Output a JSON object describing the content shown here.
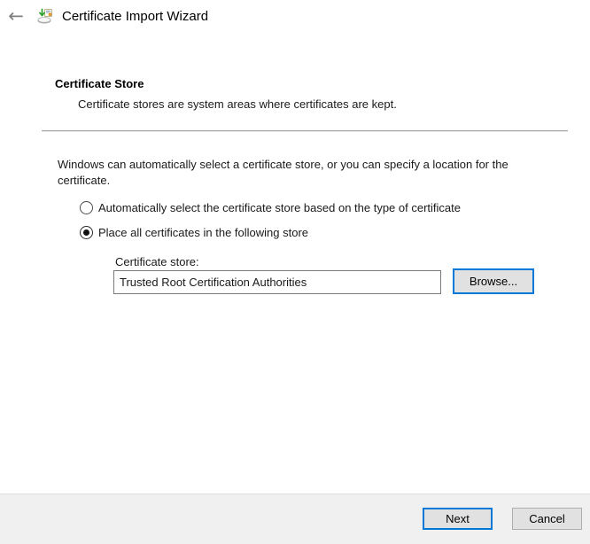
{
  "header": {
    "title": "Certificate Import Wizard"
  },
  "icons": {
    "back_arrow": "←"
  },
  "content": {
    "heading": "Certificate Store",
    "description": "Certificate stores are system areas where certificates are kept.",
    "intro": "Windows can automatically select a certificate store, or you can specify a location for the certificate.",
    "radio_options": [
      {
        "label": "Automatically select the certificate store based on the type of certificate",
        "selected": false
      },
      {
        "label": "Place all certificates in the following store",
        "selected": true
      }
    ],
    "store_label": "Certificate store:",
    "store_value": "Trusted Root Certification Authorities",
    "browse_label": "Browse..."
  },
  "footer": {
    "next_label": "Next",
    "cancel_label": "Cancel"
  },
  "colors": {
    "accent": "#0078d7",
    "button_face": "#e1e1e1",
    "button_border": "#adadad",
    "footer_bg": "#f0f0f0",
    "divider_dark": "#a9a9a9",
    "divider_light": "#e6e6e6",
    "text": "#1a1a1a",
    "back_arrow_gray": "#7e7e7e"
  }
}
